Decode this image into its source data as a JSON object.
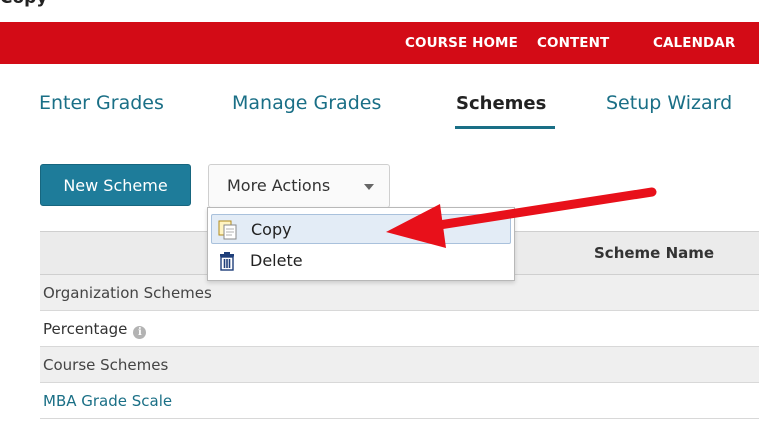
{
  "caption": {
    "prefix": "",
    "bold": "Copy",
    "suffix": ""
  },
  "topnav": {
    "items": [
      "COURSE HOME",
      "CONTENT",
      "CALENDAR"
    ],
    "color": "#d30b16"
  },
  "tabs": {
    "items": [
      "Enter Grades",
      "Manage Grades",
      "Schemes",
      "Setup Wizard"
    ],
    "active": "Schemes"
  },
  "toolbar": {
    "new_scheme": "New Scheme",
    "more_actions": "More Actions"
  },
  "dropdown": {
    "items": [
      {
        "label": "Copy",
        "icon": "copy-icon",
        "highlighted": true
      },
      {
        "label": "Delete",
        "icon": "trash-icon",
        "highlighted": false
      }
    ]
  },
  "table": {
    "header": "Scheme Name",
    "rows": [
      {
        "text": "Organization Schemes",
        "kind": "group"
      },
      {
        "text": "Percentage",
        "kind": "item"
      },
      {
        "text": "Course Schemes",
        "kind": "group"
      },
      {
        "text": "MBA Grade Scale",
        "kind": "link"
      }
    ]
  },
  "colors": {
    "accent": "#1e7c9a",
    "link": "#1a6f86",
    "annotation_arrow": "#e8101a"
  }
}
